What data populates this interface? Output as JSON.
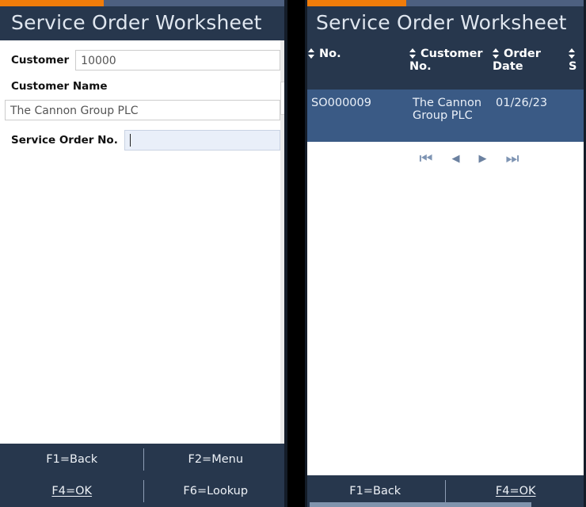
{
  "left_panel": {
    "progress_percent": 36,
    "title": "Service Order Worksheet",
    "fields": [
      {
        "label": "Customer",
        "value": "10000",
        "placeholder": "",
        "focused": false,
        "layout": "inline"
      },
      {
        "label": "Customer Name",
        "value": "The Cannon Group PLC",
        "placeholder": "",
        "focused": false,
        "layout": "stacked"
      },
      {
        "label": "Service Order No.",
        "value": "",
        "placeholder": "",
        "focused": true,
        "layout": "inline"
      }
    ],
    "keys": [
      {
        "label": "F1=Back",
        "underlined": false
      },
      {
        "label": "F2=Menu",
        "underlined": false
      },
      {
        "label": "F4=OK",
        "underlined": true
      },
      {
        "label": "F6=Lookup",
        "underlined": false
      }
    ]
  },
  "right_panel": {
    "progress_percent": 36,
    "title": "Service Order Worksheet",
    "table": {
      "columns": [
        "No.",
        "Customer No.",
        "Order Date",
        "S"
      ],
      "rows": [
        {
          "no": "SO000009",
          "customer_no": "The Cannon Group PLC",
          "order_date": "01/26/23",
          "extra": ""
        }
      ],
      "selected_row_index": 0
    },
    "pager": {
      "first": "⏮",
      "prev": "◀",
      "next": "▶",
      "last": "⏭"
    },
    "keys": [
      {
        "label": "F1=Back",
        "underlined": false
      },
      {
        "label": "F4=OK",
        "underlined": true
      }
    ]
  },
  "colors": {
    "accent_orange": "#f07c0a",
    "header_navy": "#27374d",
    "row_selected_blue": "#3a5a85",
    "focus_blue": "#e9eff9"
  }
}
